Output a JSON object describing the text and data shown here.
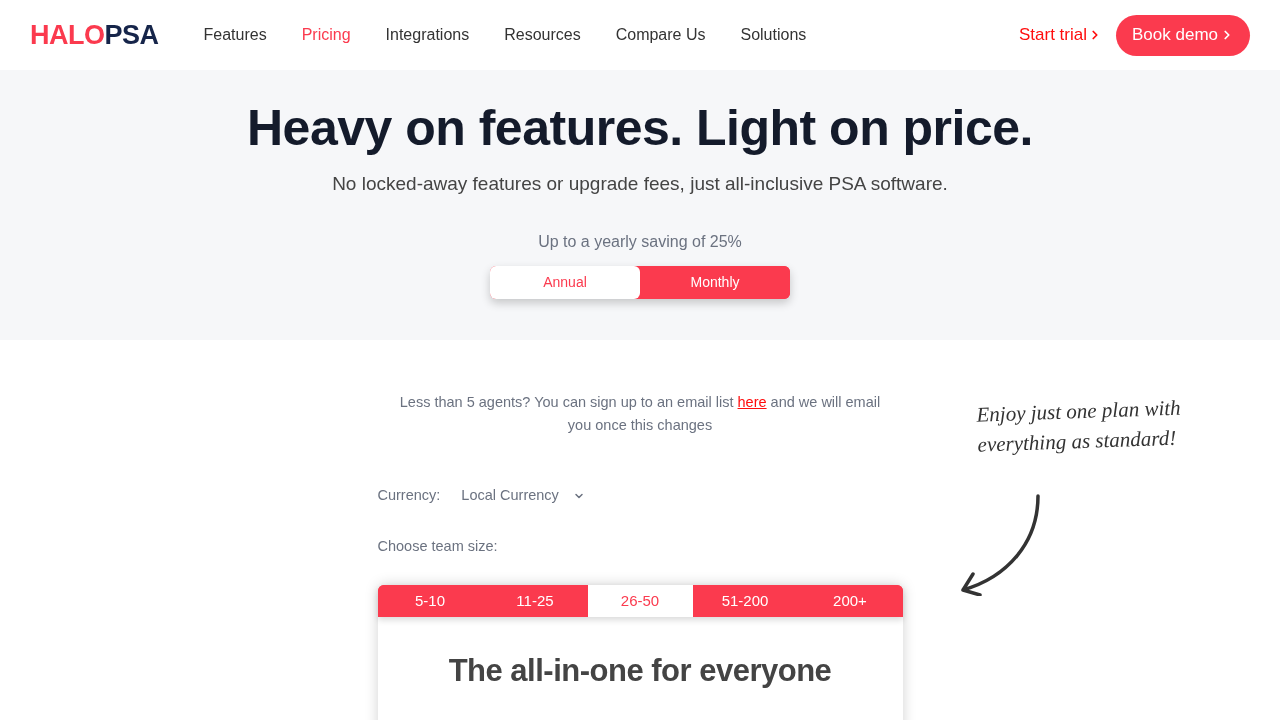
{
  "logo": {
    "part_1": "HALO",
    "part_2": "PSA"
  },
  "nav": {
    "items": [
      {
        "label": "Features",
        "selected": false
      },
      {
        "label": "Pricing",
        "selected": true
      },
      {
        "label": "Integrations",
        "selected": false
      },
      {
        "label": "Resources",
        "selected": false
      },
      {
        "label": "Compare Us",
        "selected": false
      },
      {
        "label": "Solutions",
        "selected": false
      }
    ]
  },
  "actions": {
    "start_trial": "Start trial",
    "book_demo": "Book demo"
  },
  "hero": {
    "title": "Heavy on features. Light on price.",
    "subtitle": "No locked-away features or upgrade fees, just all-inclusive PSA software.",
    "saving_note": "Up to a yearly saving of 25%",
    "billing_toggle": [
      {
        "label": "Annual",
        "selected": true
      },
      {
        "label": "Monthly",
        "selected": false
      }
    ]
  },
  "pricing": {
    "notice": {
      "before": "Less than 5 agents? You can sign up to an email list",
      "link": "here",
      "after": "and we will email you once this changes"
    },
    "currency": {
      "label": "Currency:",
      "value": "Local Currency"
    },
    "team_size_label": "Choose team size:",
    "team_sizes": [
      {
        "label": "5-10",
        "selected": false
      },
      {
        "label": "11-25",
        "selected": false
      },
      {
        "label": "26-50",
        "selected": true
      },
      {
        "label": "51-200",
        "selected": false
      },
      {
        "label": "200+",
        "selected": false
      }
    ],
    "plan_card": {
      "title": "The all-in-one for everyone"
    }
  },
  "callout": {
    "text": "Enjoy just one plan with everything as standard!"
  }
}
